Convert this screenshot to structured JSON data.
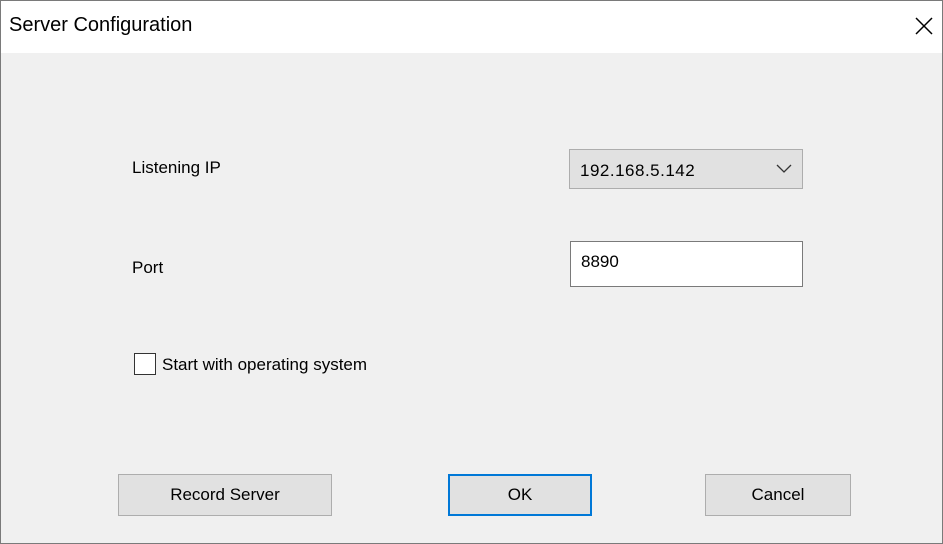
{
  "window": {
    "title": "Server Configuration"
  },
  "form": {
    "listening_ip_label": "Listening IP",
    "listening_ip_value": "192.168.5.142",
    "port_label": "Port",
    "port_value": "8890",
    "start_with_os_label": "Start with operating system",
    "start_with_os_checked": false
  },
  "buttons": {
    "record_server": "Record Server",
    "ok": "OK",
    "cancel": "Cancel"
  },
  "icons": {
    "close": "close-icon",
    "dropdown": "chevron-down-icon"
  },
  "colors": {
    "accent": "#0078d7",
    "dialog_background": "#f0f0f0",
    "titlebar_background": "#ffffff",
    "button_face": "#e1e1e1"
  }
}
